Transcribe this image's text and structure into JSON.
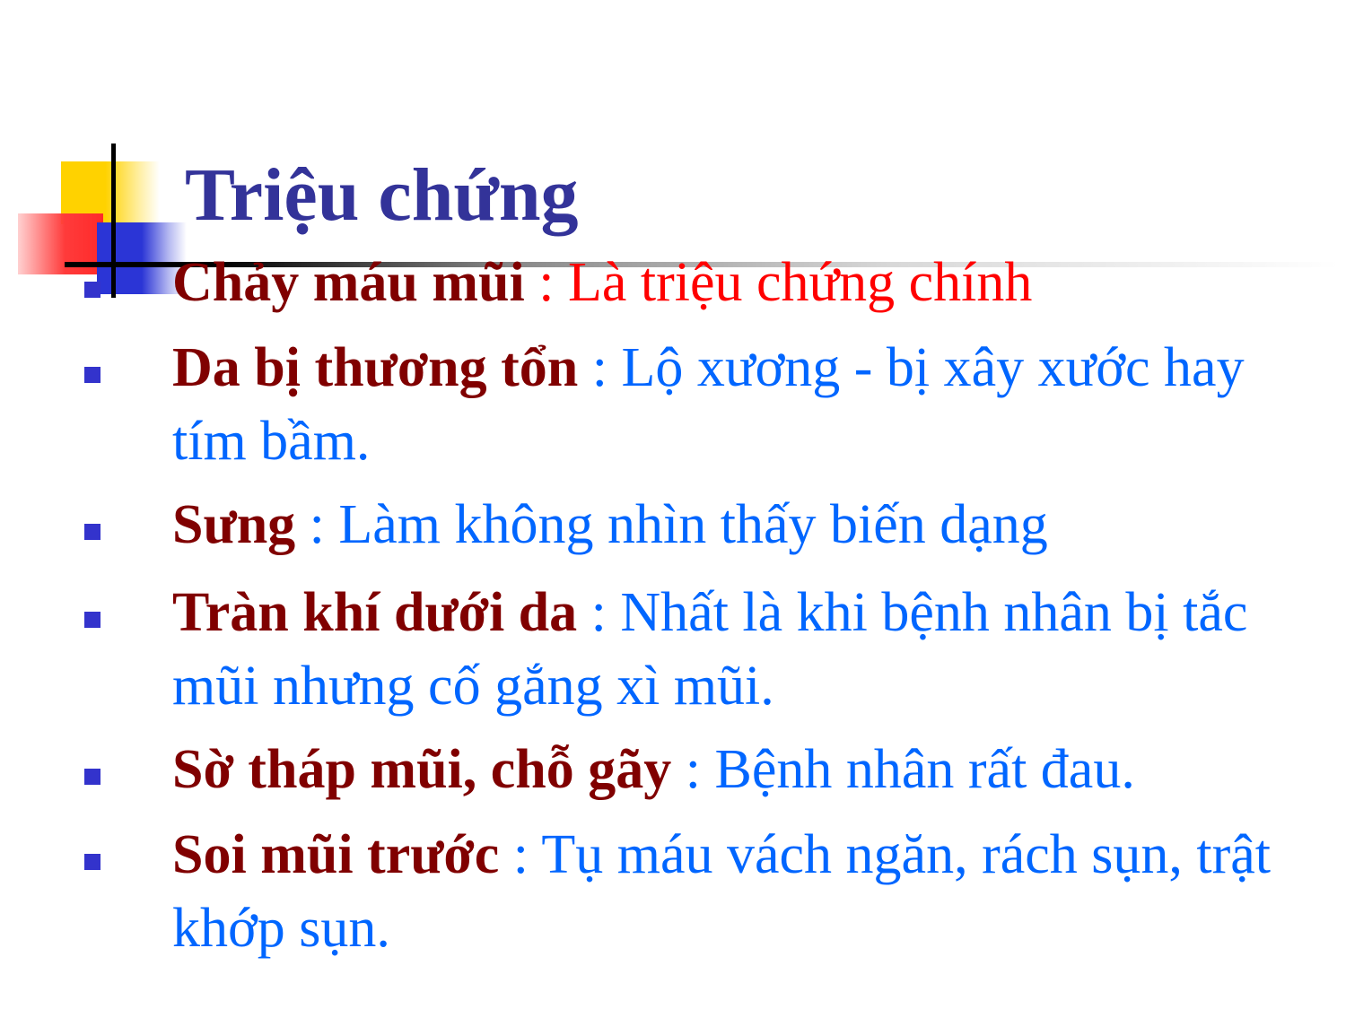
{
  "title": "Triệu chứng",
  "items": [
    {
      "term": "Chảy máu mũi",
      "sep": " : ",
      "desc": "Là triệu chứng chính"
    },
    {
      "term": "Da bị thương tổn",
      "sep": " : ",
      "desc": "Lộ xương - bị xây xước hay tím bầm."
    },
    {
      "term": "Sưng",
      "sep": " : ",
      "desc": "Làm không nhìn thấy biến dạng"
    },
    {
      "term": "Tràn khí dưới da",
      "sep": " : ",
      "desc": "Nhất là khi bệnh nhân bị tắc mũi nhưng cố gắng xì mũi."
    },
    {
      "term": "Sờ tháp mũi, chỗ gãy",
      "sep": " : ",
      "desc": "Bệnh nhân rất đau."
    },
    {
      "term": "Soi mũi trước",
      "sep": " : ",
      "desc": "Tụ máu vách ngăn, rách sụn, trật khớp sụn."
    }
  ],
  "colors": {
    "title": "#333399",
    "term": "#800000",
    "desc": "#0066ff",
    "first_desc": "#ff0000",
    "bullet": "#3333cc"
  }
}
